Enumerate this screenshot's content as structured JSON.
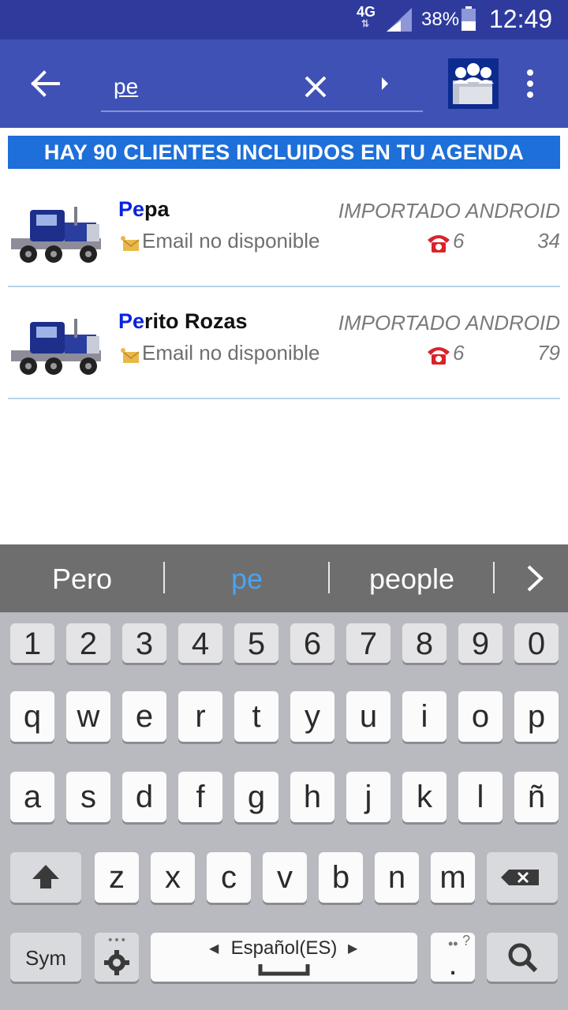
{
  "status_bar": {
    "network": "4G",
    "battery_pct": "38%",
    "time": "12:49"
  },
  "appbar": {
    "search_value": "pe",
    "search_placeholder": ""
  },
  "banner": {
    "text": "HAY 90 CLIENTES INCLUIDOS EN TU AGENDA"
  },
  "contacts": [
    {
      "name_highlight": "Pe",
      "name_rest": "pa",
      "source": "IMPORTADO ANDROID",
      "email": "Email no disponible",
      "phone_start": "6",
      "phone_end": "34"
    },
    {
      "name_highlight": "Pe",
      "name_rest": "rito Rozas",
      "source": "IMPORTADO ANDROID",
      "email": "Email no disponible",
      "phone_start": "6",
      "phone_end": "79"
    }
  ],
  "suggestions": [
    "Pero",
    "pe",
    "people"
  ],
  "keyboard": {
    "numbers": [
      "1",
      "2",
      "3",
      "4",
      "5",
      "6",
      "7",
      "8",
      "9",
      "0"
    ],
    "row1": [
      "q",
      "w",
      "e",
      "r",
      "t",
      "y",
      "u",
      "i",
      "o",
      "p"
    ],
    "row2": [
      "a",
      "s",
      "d",
      "f",
      "g",
      "h",
      "j",
      "k",
      "l",
      "ñ"
    ],
    "row3": [
      "z",
      "x",
      "c",
      "v",
      "b",
      "n",
      "m"
    ],
    "sym_label": "Sym",
    "space_label": "Español(ES)",
    "period_label": ".",
    "period_hint": "?"
  },
  "colors": {
    "status_bar": "#2f3b9c",
    "appbar": "#3f51b5",
    "banner": "#1e6fd9",
    "name_highlight": "#0a23e0",
    "suggestion_active": "#4aa3f0"
  },
  "icons": {
    "back": "arrow-left-icon",
    "clear": "close-icon",
    "forward": "play-arrow-icon",
    "contacts": "group-contacts-icon",
    "menu": "more-vertical-icon",
    "email": "envelope-icon",
    "phone": "phone-icon",
    "avatar": "truck-icon",
    "shift": "shift-arrow-icon",
    "backspace": "backspace-icon",
    "settings": "gear-icon",
    "search": "magnifier-icon"
  }
}
